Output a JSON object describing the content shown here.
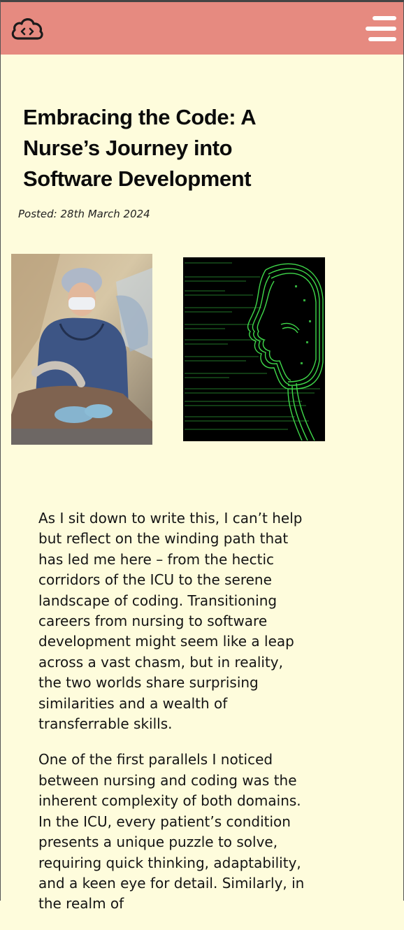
{
  "header": {
    "logo_icon": "cloud-code-icon",
    "menu_icon": "hamburger-menu-icon",
    "background": "#e68a80"
  },
  "article": {
    "title": "Embracing the Code: A Nurse’s Journey into Software Development",
    "posted": "Posted: 28th March 2024",
    "images": [
      {
        "name": "nurse-illustration"
      },
      {
        "name": "code-face-illustration"
      }
    ],
    "paragraphs": [
      "As I sit down to write this, I can’t help but reflect on the winding path that has led me here – from the hectic corridors of the ICU to the serene landscape of coding. Transitioning careers from nursing to software development might seem like a leap across a vast chasm, but in reality, the two worlds share surprising similarities and a wealth of transferrable skills.",
      "One of the first parallels I noticed between nursing and coding was the inherent complexity of both domains. In the ICU, every patient’s condition presents a unique puzzle to solve, requiring quick thinking, adaptability, and a keen eye for detail. Similarly, in the realm of"
    ]
  },
  "colors": {
    "page_background": "#fefcdc",
    "header_background": "#e68a80",
    "code_green": "#3fd84a"
  }
}
